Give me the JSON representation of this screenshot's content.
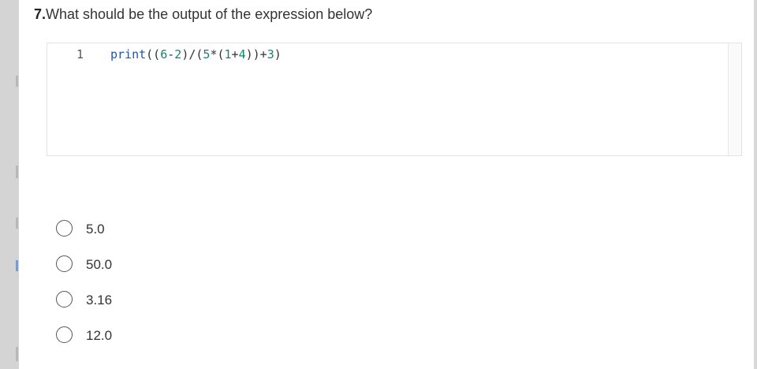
{
  "question": {
    "number": "7.",
    "text": "What should be the output of the expression below?"
  },
  "code": {
    "line_number": "1",
    "tokens": {
      "t1": "print",
      "t2": "((",
      "t3": "6",
      "t4": "-",
      "t5": "2",
      "t6": ")/(",
      "t7": "5",
      "t8": "*(",
      "t9": "1",
      "t10": "+",
      "t11": "4",
      "t12": "))+",
      "t13": "3",
      "t14": ")"
    }
  },
  "options": [
    "5.0",
    "50.0",
    "3.16",
    "12.0"
  ],
  "colors": {
    "keyword": "#2255aa",
    "number": "#11866a",
    "text": "#333333"
  }
}
